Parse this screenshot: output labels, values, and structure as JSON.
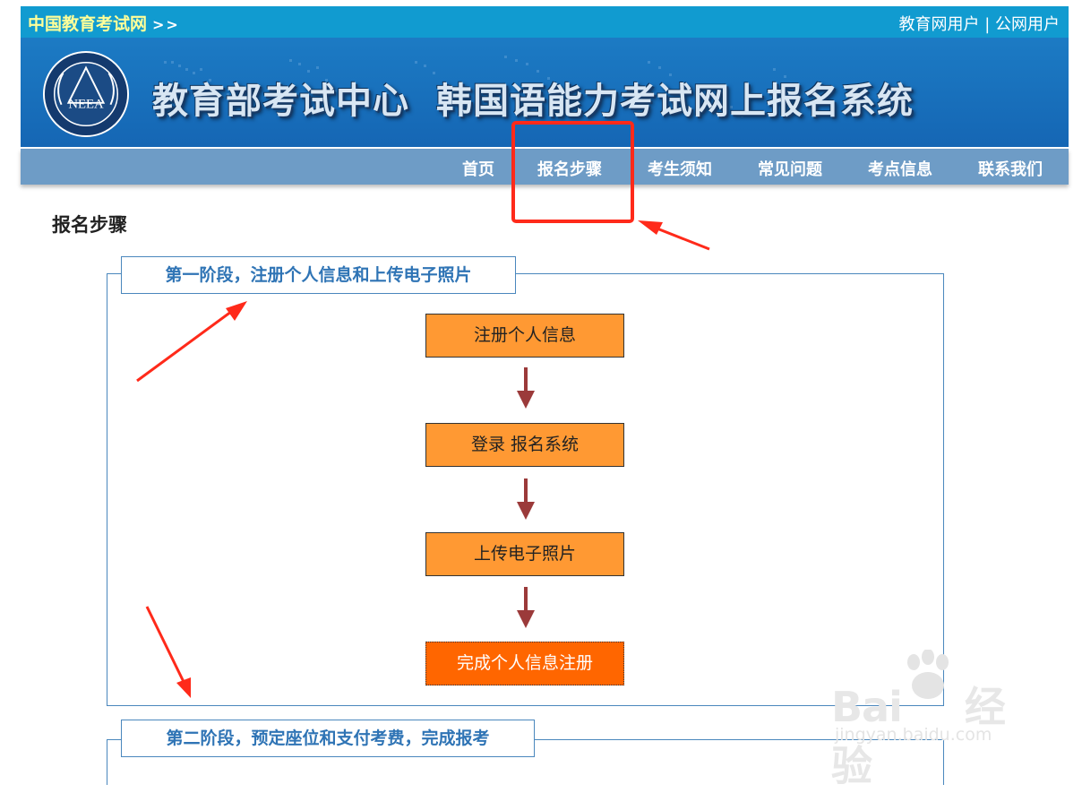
{
  "header": {
    "site_name": "中国教育考试网",
    "site_arrow": ">>",
    "user_edu": "教育网用户",
    "separator": "|",
    "user_public": "公网用户"
  },
  "banner": {
    "org_title": "教育部考试中心",
    "system_title": "韩国语能力考试网上报名系统",
    "logo_text": "NEEA"
  },
  "nav": {
    "items": [
      "首页",
      "报名步骤",
      "考生须知",
      "常见问题",
      "考点信息",
      "联系我们"
    ],
    "highlighted": "报名步骤"
  },
  "page_title": "报名步骤",
  "phases": [
    {
      "label": "第一阶段，注册个人信息和上传电子照片",
      "steps": [
        "注册个人信息",
        "登录 报名系统",
        "上传电子照片",
        "完成个人信息注册"
      ]
    },
    {
      "label": "第二阶段，预定座位和支付考费，完成报考"
    }
  ],
  "watermark": {
    "brand": "Bai",
    "brand2": "经验",
    "url": "jingyan.baidu.com"
  },
  "colors": {
    "topbar": "#119bd0",
    "banner": "#1566b4",
    "nav": "#6e9cc6",
    "step": "#ff9933",
    "step_final": "#ff6600",
    "arrow": "#9b3a3a",
    "callout": "#ff2a1a",
    "phase_label": "#2f74b5"
  }
}
